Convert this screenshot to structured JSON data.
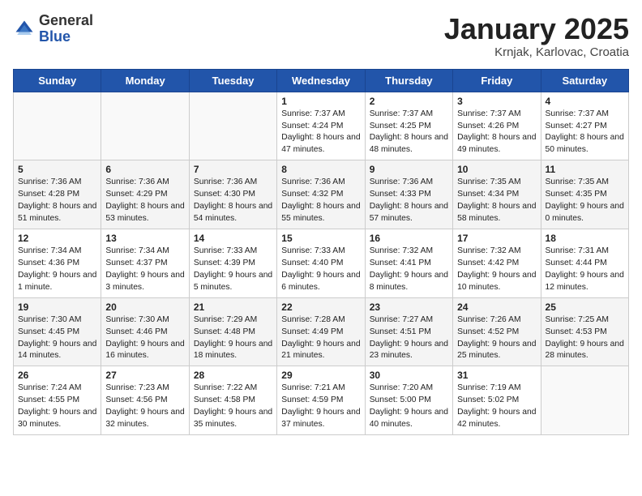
{
  "header": {
    "logo_general": "General",
    "logo_blue": "Blue",
    "month_title": "January 2025",
    "subtitle": "Krnjak, Karlovac, Croatia"
  },
  "weekdays": [
    "Sunday",
    "Monday",
    "Tuesday",
    "Wednesday",
    "Thursday",
    "Friday",
    "Saturday"
  ],
  "weeks": [
    [
      {
        "day": "",
        "text": ""
      },
      {
        "day": "",
        "text": ""
      },
      {
        "day": "",
        "text": ""
      },
      {
        "day": "1",
        "text": "Sunrise: 7:37 AM\nSunset: 4:24 PM\nDaylight: 8 hours and 47 minutes."
      },
      {
        "day": "2",
        "text": "Sunrise: 7:37 AM\nSunset: 4:25 PM\nDaylight: 8 hours and 48 minutes."
      },
      {
        "day": "3",
        "text": "Sunrise: 7:37 AM\nSunset: 4:26 PM\nDaylight: 8 hours and 49 minutes."
      },
      {
        "day": "4",
        "text": "Sunrise: 7:37 AM\nSunset: 4:27 PM\nDaylight: 8 hours and 50 minutes."
      }
    ],
    [
      {
        "day": "5",
        "text": "Sunrise: 7:36 AM\nSunset: 4:28 PM\nDaylight: 8 hours and 51 minutes."
      },
      {
        "day": "6",
        "text": "Sunrise: 7:36 AM\nSunset: 4:29 PM\nDaylight: 8 hours and 53 minutes."
      },
      {
        "day": "7",
        "text": "Sunrise: 7:36 AM\nSunset: 4:30 PM\nDaylight: 8 hours and 54 minutes."
      },
      {
        "day": "8",
        "text": "Sunrise: 7:36 AM\nSunset: 4:32 PM\nDaylight: 8 hours and 55 minutes."
      },
      {
        "day": "9",
        "text": "Sunrise: 7:36 AM\nSunset: 4:33 PM\nDaylight: 8 hours and 57 minutes."
      },
      {
        "day": "10",
        "text": "Sunrise: 7:35 AM\nSunset: 4:34 PM\nDaylight: 8 hours and 58 minutes."
      },
      {
        "day": "11",
        "text": "Sunrise: 7:35 AM\nSunset: 4:35 PM\nDaylight: 9 hours and 0 minutes."
      }
    ],
    [
      {
        "day": "12",
        "text": "Sunrise: 7:34 AM\nSunset: 4:36 PM\nDaylight: 9 hours and 1 minute."
      },
      {
        "day": "13",
        "text": "Sunrise: 7:34 AM\nSunset: 4:37 PM\nDaylight: 9 hours and 3 minutes."
      },
      {
        "day": "14",
        "text": "Sunrise: 7:33 AM\nSunset: 4:39 PM\nDaylight: 9 hours and 5 minutes."
      },
      {
        "day": "15",
        "text": "Sunrise: 7:33 AM\nSunset: 4:40 PM\nDaylight: 9 hours and 6 minutes."
      },
      {
        "day": "16",
        "text": "Sunrise: 7:32 AM\nSunset: 4:41 PM\nDaylight: 9 hours and 8 minutes."
      },
      {
        "day": "17",
        "text": "Sunrise: 7:32 AM\nSunset: 4:42 PM\nDaylight: 9 hours and 10 minutes."
      },
      {
        "day": "18",
        "text": "Sunrise: 7:31 AM\nSunset: 4:44 PM\nDaylight: 9 hours and 12 minutes."
      }
    ],
    [
      {
        "day": "19",
        "text": "Sunrise: 7:30 AM\nSunset: 4:45 PM\nDaylight: 9 hours and 14 minutes."
      },
      {
        "day": "20",
        "text": "Sunrise: 7:30 AM\nSunset: 4:46 PM\nDaylight: 9 hours and 16 minutes."
      },
      {
        "day": "21",
        "text": "Sunrise: 7:29 AM\nSunset: 4:48 PM\nDaylight: 9 hours and 18 minutes."
      },
      {
        "day": "22",
        "text": "Sunrise: 7:28 AM\nSunset: 4:49 PM\nDaylight: 9 hours and 21 minutes."
      },
      {
        "day": "23",
        "text": "Sunrise: 7:27 AM\nSunset: 4:51 PM\nDaylight: 9 hours and 23 minutes."
      },
      {
        "day": "24",
        "text": "Sunrise: 7:26 AM\nSunset: 4:52 PM\nDaylight: 9 hours and 25 minutes."
      },
      {
        "day": "25",
        "text": "Sunrise: 7:25 AM\nSunset: 4:53 PM\nDaylight: 9 hours and 28 minutes."
      }
    ],
    [
      {
        "day": "26",
        "text": "Sunrise: 7:24 AM\nSunset: 4:55 PM\nDaylight: 9 hours and 30 minutes."
      },
      {
        "day": "27",
        "text": "Sunrise: 7:23 AM\nSunset: 4:56 PM\nDaylight: 9 hours and 32 minutes."
      },
      {
        "day": "28",
        "text": "Sunrise: 7:22 AM\nSunset: 4:58 PM\nDaylight: 9 hours and 35 minutes."
      },
      {
        "day": "29",
        "text": "Sunrise: 7:21 AM\nSunset: 4:59 PM\nDaylight: 9 hours and 37 minutes."
      },
      {
        "day": "30",
        "text": "Sunrise: 7:20 AM\nSunset: 5:00 PM\nDaylight: 9 hours and 40 minutes."
      },
      {
        "day": "31",
        "text": "Sunrise: 7:19 AM\nSunset: 5:02 PM\nDaylight: 9 hours and 42 minutes."
      },
      {
        "day": "",
        "text": ""
      }
    ]
  ]
}
